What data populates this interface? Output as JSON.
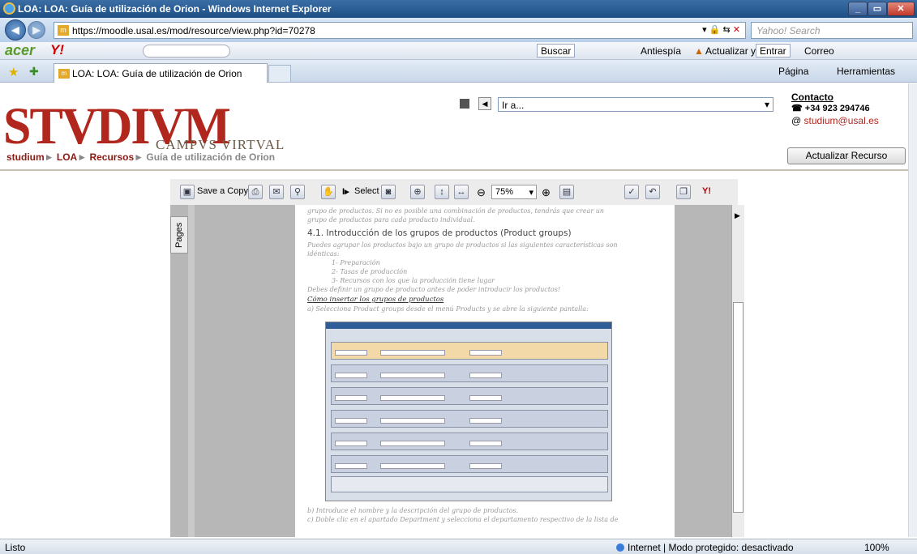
{
  "window": {
    "title": "LOA: LOA: Guía de utilización de Orion - Windows Internet Explorer"
  },
  "address": {
    "url": "https://moodle.usal.es/mod/resource/view.php?id=70278",
    "search_placeholder": "Yahoo! Search"
  },
  "toolbar": {
    "buscar": "Buscar",
    "antiespia": "Antiespía",
    "actualizar_ya": "Actualizar ya",
    "entrar": "Entrar",
    "correo": "Correo"
  },
  "tab": {
    "title": "LOA: LOA: Guía de utilización de Orion"
  },
  "command_bar": {
    "pagina": "Página",
    "herramientas": "Herramientas"
  },
  "site": {
    "logo_main": "STVDIVM",
    "logo_sub": "CAMPVS VIRTVAL",
    "goto_label": "Ir a...",
    "contact_title": "Contacto",
    "phone": "+34 923 294746",
    "email": "studium@usal.es",
    "update_button": "Actualizar Recurso"
  },
  "breadcrumb": {
    "studium": "studium",
    "loa": "LOA",
    "recursos": "Recursos",
    "current": "Guía de utilización de Orion"
  },
  "pdf": {
    "save_copy": "Save a Copy",
    "select": "Select",
    "zoom": "75%",
    "pages_tab": "Pages"
  },
  "doc": {
    "line0": "grupo de productos. Si no es posible una combinación de productos, tendrás que crear un",
    "line1": "grupo de productos para cada producto individual.",
    "heading": "4.1. Introducción de los grupos de productos (Product groups)",
    "p1": "Puedes agrupar los productos bajo un grupo de productos si las siguientes características son",
    "p1b": "idénticas:",
    "li1": "1- Preparación",
    "li2": "2- Tasas de producción",
    "li3": "3- Recursos con los que la producción tiene lugar",
    "p2": "Debes definir un grupo de producto antes de poder introducir los productos!",
    "sub": "Cómo insertar los grupos de productos",
    "a": "a) Selecciona Product groups desde el menú Products y se abre la siguiente pantalla:",
    "b": "b) Introduce el nombre y la descripción del grupo de productos.",
    "c": "c) Doble clic en el apartado Department y selecciona el departamento respectivo de la lista de"
  },
  "status": {
    "left": "Listo",
    "zone": "Internet | Modo protegido: desactivado",
    "zoom": "100%"
  }
}
